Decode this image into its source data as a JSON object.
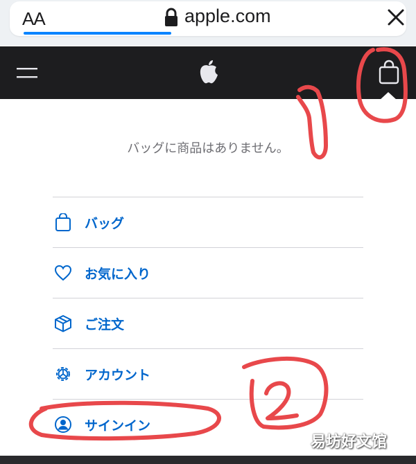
{
  "browser": {
    "text_size_button": "AA",
    "domain": "apple.com",
    "close_icon": "close-icon",
    "lock_icon": "lock-icon",
    "load_progress_percent": 38
  },
  "nav": {
    "menu_icon": "menu-icon",
    "logo": "apple-logo",
    "bag_icon": "bag-icon"
  },
  "bag_panel": {
    "empty_message": "バッグに商品はありません。",
    "items": [
      {
        "label": "バッグ",
        "icon": "bag-icon"
      },
      {
        "label": "お気に入り",
        "icon": "heart-icon"
      },
      {
        "label": "ご注文",
        "icon": "box-icon"
      },
      {
        "label": "アカウント",
        "icon": "gear-icon"
      },
      {
        "label": "サインイン",
        "icon": "person-circle-icon"
      }
    ]
  },
  "annotations": {
    "marker_1": "1",
    "marker_2": "2",
    "annotation_color": "#e8484b"
  },
  "watermark": "易坊好文馆",
  "colors": {
    "nav_bg": "#1d1d1f",
    "link": "#0066cc",
    "progress": "#0a84ff"
  }
}
